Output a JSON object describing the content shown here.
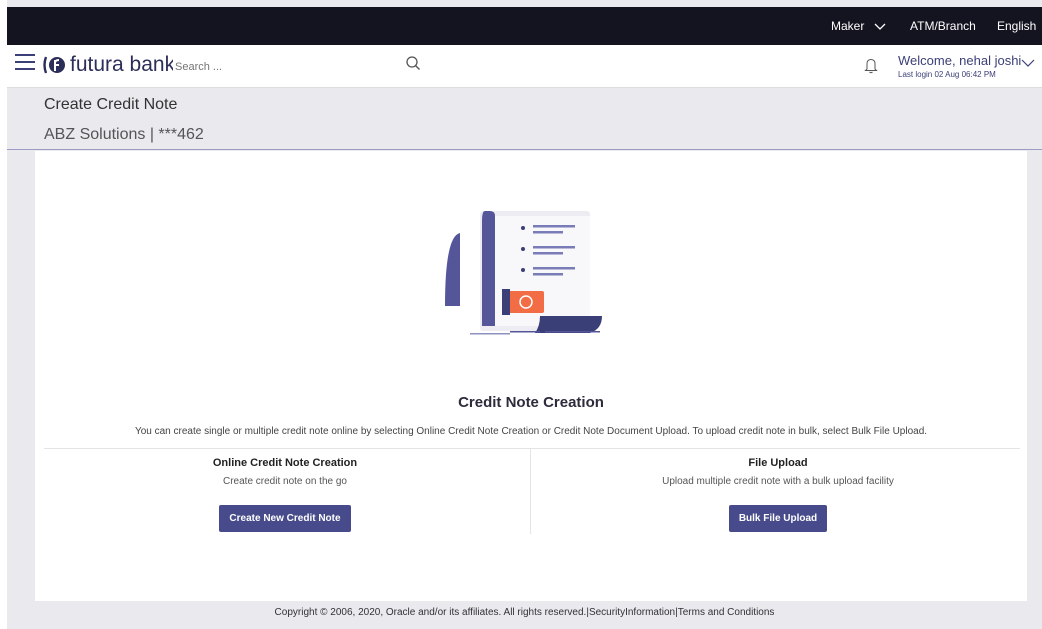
{
  "topbar": {
    "role": "Maker",
    "atm_branch": "ATM/Branch",
    "language": "English"
  },
  "header": {
    "brand": "futura bank",
    "search_placeholder": "Search ...",
    "welcome": "Welcome, nehal joshi",
    "last_login": "Last login 02 Aug 06:42 PM"
  },
  "page": {
    "title": "Create Credit Note",
    "subtitle": "ABZ Solutions | ***462"
  },
  "card": {
    "title": "Credit Note Creation",
    "description": "You can create single or multiple credit note online by selecting Online Credit Note Creation or Credit Note Document Upload. To upload credit note in bulk, select Bulk File Upload.",
    "online": {
      "heading": "Online Credit Note Creation",
      "sub": "Create credit note on the go",
      "button": "Create New Credit Note"
    },
    "upload": {
      "heading": "File Upload",
      "sub": "Upload multiple credit note with a bulk upload facility",
      "button": "Bulk File Upload"
    }
  },
  "footer": {
    "copyright": "Copyright © 2006, 2020, Oracle and/or its affiliates. All rights reserved.",
    "security": "SecurityInformation",
    "terms": "Terms and Conditions"
  },
  "colors": {
    "primary": "#474b8b",
    "topbar": "#141421",
    "accent": "#f26d46"
  }
}
